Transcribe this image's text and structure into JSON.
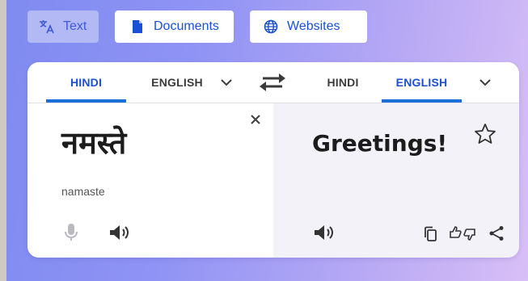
{
  "mode_tabs": [
    {
      "label": "Text",
      "icon": "translate-icon",
      "active": true
    },
    {
      "label": "Documents",
      "icon": "document-icon",
      "active": false
    },
    {
      "label": "Websites",
      "icon": "globe-icon",
      "active": false
    }
  ],
  "source_languages": {
    "lang1": "HINDI",
    "lang2": "ENGLISH",
    "active": "HINDI"
  },
  "target_languages": {
    "lang1": "HINDI",
    "lang2": "ENGLISH",
    "active": "ENGLISH"
  },
  "source": {
    "text": "नमस्ते",
    "transliteration": "namaste"
  },
  "target": {
    "text": "Greetings!"
  },
  "colors": {
    "accent": "#1a4fd8",
    "active_underline": "#1a6fd8",
    "target_bg": "#f3f2f8"
  }
}
